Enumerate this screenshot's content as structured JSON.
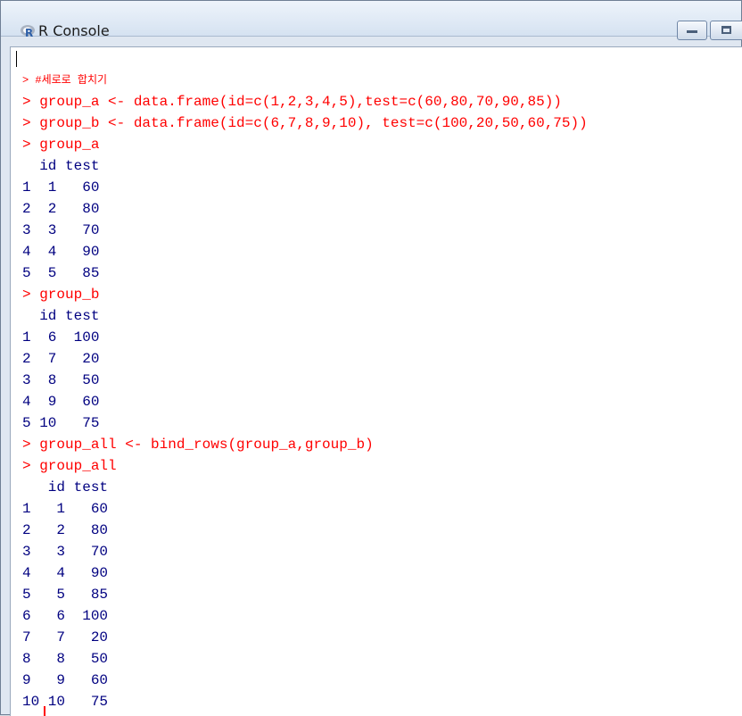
{
  "window": {
    "title": "R Console",
    "icon": "r-logo-icon",
    "buttons": [
      "minimize-icon",
      "maximize-icon"
    ]
  },
  "console": {
    "lines": [
      {
        "type": "input",
        "text": "> #세로로 합치기"
      },
      {
        "type": "input",
        "text": "> group_a <- data.frame(id=c(1,2,3,4,5),test=c(60,80,70,90,85))"
      },
      {
        "type": "input",
        "text": "> group_b <- data.frame(id=c(6,7,8,9,10), test=c(100,20,50,60,75))"
      },
      {
        "type": "input",
        "text": "> group_a"
      },
      {
        "type": "output",
        "text": "  id test"
      },
      {
        "type": "output",
        "text": "1  1   60"
      },
      {
        "type": "output",
        "text": "2  2   80"
      },
      {
        "type": "output",
        "text": "3  3   70"
      },
      {
        "type": "output",
        "text": "4  4   90"
      },
      {
        "type": "output",
        "text": "5  5   85"
      },
      {
        "type": "input",
        "text": "> group_b"
      },
      {
        "type": "output",
        "text": "  id test"
      },
      {
        "type": "output",
        "text": "1  6  100"
      },
      {
        "type": "output",
        "text": "2  7   20"
      },
      {
        "type": "output",
        "text": "3  8   50"
      },
      {
        "type": "output",
        "text": "4  9   60"
      },
      {
        "type": "output",
        "text": "5 10   75"
      },
      {
        "type": "input",
        "text": "> group_all <- bind_rows(group_a,group_b)"
      },
      {
        "type": "input",
        "text": "> group_all"
      },
      {
        "type": "output",
        "text": "   id test"
      },
      {
        "type": "output",
        "text": "1   1   60"
      },
      {
        "type": "output",
        "text": "2   2   80"
      },
      {
        "type": "output",
        "text": "3   3   70"
      },
      {
        "type": "output",
        "text": "4   4   90"
      },
      {
        "type": "output",
        "text": "5   5   85"
      },
      {
        "type": "output",
        "text": "6   6  100"
      },
      {
        "type": "output",
        "text": "7   7   20"
      },
      {
        "type": "output",
        "text": "8   8   50"
      },
      {
        "type": "output",
        "text": "9   9   60"
      },
      {
        "type": "output",
        "text": "10 10   75"
      }
    ]
  },
  "colors": {
    "input": "#ff0000",
    "output": "#000080"
  }
}
